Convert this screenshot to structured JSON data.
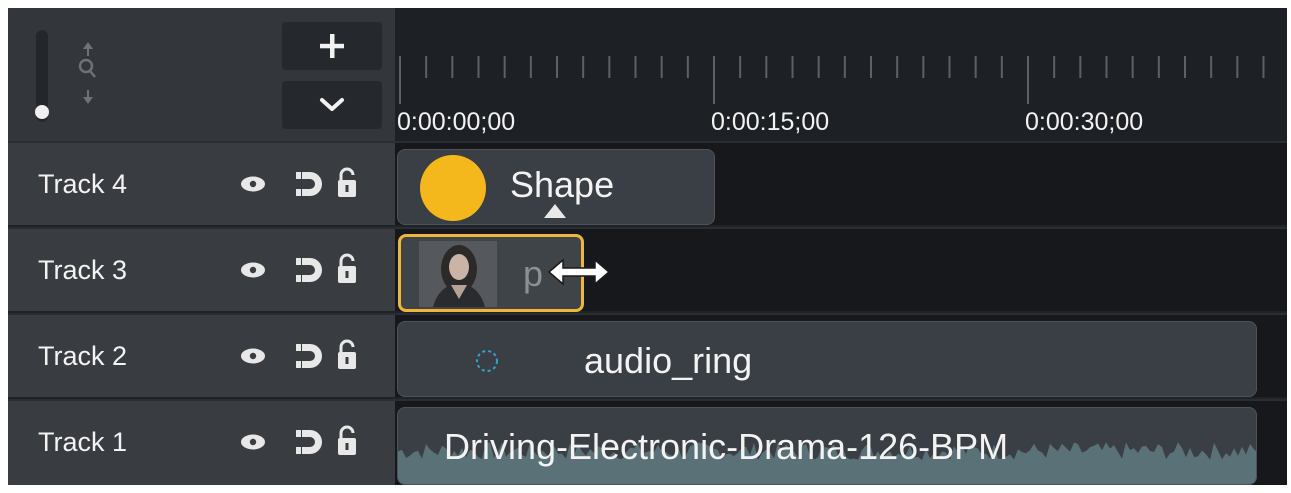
{
  "header": {
    "add_button": {
      "label": "+",
      "icon": "plus-icon"
    },
    "menu_button": {
      "label": "⌄",
      "icon": "chevron-down-icon"
    },
    "zoom_slider": {
      "level": 0.05
    },
    "zoom_icon": "magnify-zoom-icon"
  },
  "ruler": {
    "timecodes": [
      "0:00:00;00",
      "0:00:15;00",
      "0:00:30;00"
    ]
  },
  "tracks": [
    {
      "label": "Track 4"
    },
    {
      "label": "Track 3"
    },
    {
      "label": "Track 2"
    },
    {
      "label": "Track 1"
    }
  ],
  "track_icons": [
    "eye-icon",
    "magnet-icon",
    "lock-icon"
  ],
  "clips": {
    "shape": {
      "label": "Shape",
      "color": "#f5b81c"
    },
    "media": {
      "label": "p"
    },
    "audio_ring": {
      "label": "audio_ring",
      "icon": "ring-icon",
      "color": "#2ea7c9"
    },
    "music": {
      "label": "Driving-Electronic-Drama-126-BPM"
    }
  },
  "colors": {
    "selected_outline": "#f0b63a",
    "waveform": "#5f7a80"
  }
}
